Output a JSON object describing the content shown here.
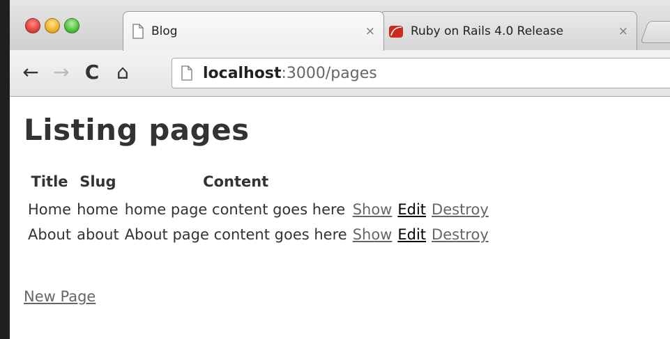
{
  "browser": {
    "tabs": [
      {
        "title": "Blog",
        "close": "×",
        "active": true,
        "favicon": "document-icon"
      },
      {
        "title": "Ruby on Rails 4.0 Release",
        "close": "×",
        "active": false,
        "favicon": "rails-icon"
      }
    ],
    "nav": {
      "back": "←",
      "forward": "→",
      "reload": "C",
      "home": "⌂"
    },
    "url": {
      "host": "localhost",
      "rest": ":3000/pages"
    }
  },
  "page": {
    "heading": "Listing pages",
    "columns": [
      "Title",
      "Slug",
      "Content",
      "",
      "",
      ""
    ],
    "rows": [
      {
        "title": "Home",
        "slug": "home",
        "content": "home page content goes here",
        "show": "Show",
        "edit": "Edit",
        "destroy": "Destroy"
      },
      {
        "title": "About",
        "slug": "about",
        "content": "About page content goes here",
        "show": "Show",
        "edit": "Edit",
        "destroy": "Destroy"
      }
    ],
    "new_link": "New Page"
  },
  "colors": {
    "text": "#333333",
    "link": "#666666",
    "visited_link": "#000000",
    "rails_red": "#cc2a1f"
  }
}
